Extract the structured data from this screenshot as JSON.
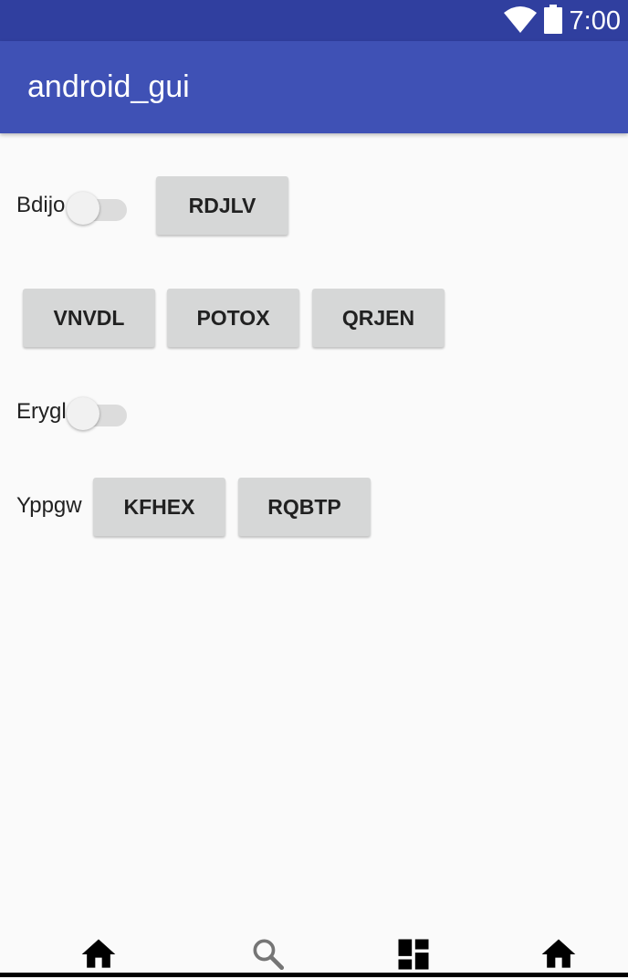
{
  "status_bar": {
    "time": "7:00",
    "icons": [
      "wifi-icon",
      "battery-icon"
    ]
  },
  "app_bar": {
    "title": "android_gui"
  },
  "rows": {
    "row1": {
      "switch_label": "Bdijo",
      "switch_on": false,
      "button": "RDJLV"
    },
    "row2": {
      "buttons": [
        "VNVDL",
        "POTOX",
        "QRJEN"
      ]
    },
    "row3": {
      "switch_label": "Erygl",
      "switch_on": false
    },
    "row4": {
      "label": "Yppgw",
      "buttons": [
        "KFHEX",
        "RQBTP"
      ]
    }
  },
  "bottom_nav": {
    "icons": [
      "home-icon",
      "search-icon",
      "dashboard-icon",
      "home-icon"
    ]
  },
  "colors": {
    "status_bar": "#303f9f",
    "app_bar": "#3f51b5",
    "background": "#fafafa",
    "button": "#d6d7d7"
  }
}
